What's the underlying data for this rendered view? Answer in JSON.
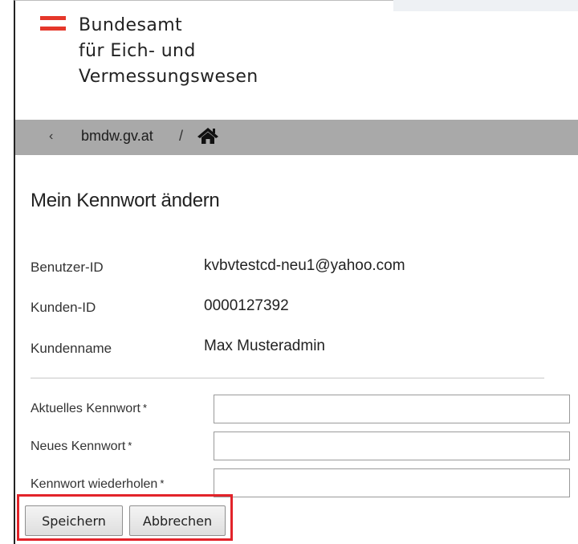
{
  "header": {
    "org_line1": "Bundesamt",
    "org_line2": "für Eich- und",
    "org_line3": "Vermessungswesen"
  },
  "nav": {
    "back_glyph": "‹",
    "link_label": "bmdw.gv.at",
    "separator": "/",
    "home_icon": "home-icon"
  },
  "page": {
    "title": "Mein Kennwort ändern"
  },
  "info": {
    "user_id_label": "Benutzer-ID",
    "user_id_value": "kvbvtestcd-neu1@yahoo.com",
    "customer_id_label": "Kunden-ID",
    "customer_id_value": "0000127392",
    "customer_name_label": "Kundenname",
    "customer_name_value": "Max Musteradmin"
  },
  "form": {
    "current_label": "Aktuelles Kennwort",
    "new_label": "Neues Kennwort",
    "repeat_label": "Kennwort wiederholen",
    "required_mark": "*",
    "current_value": "",
    "new_value": "",
    "repeat_value": ""
  },
  "buttons": {
    "save_label": "Speichern",
    "cancel_label": "Abbrechen"
  },
  "colors": {
    "logo_red": "#e5372a",
    "nav_bg": "#a9a9a9",
    "highlight_red": "#e2232a"
  }
}
